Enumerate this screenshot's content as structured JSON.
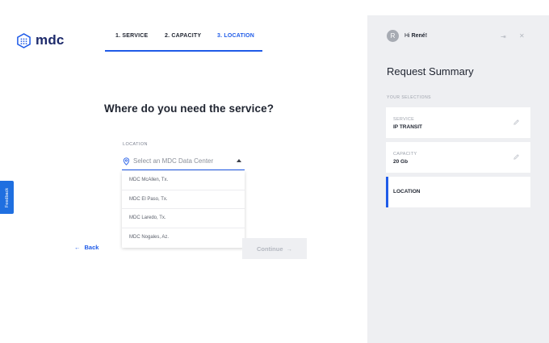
{
  "brand": {
    "name": "mdc",
    "color": "#1d2a6b"
  },
  "steps": [
    {
      "label": "1. SERVICE",
      "active": false
    },
    {
      "label": "2. CAPACITY",
      "active": false
    },
    {
      "label": "3. LOCATION",
      "active": true
    }
  ],
  "question": "Where do you need the service?",
  "location": {
    "label": "LOCATION",
    "placeholder": "Select an MDC Data Center",
    "options": [
      "MDC McAllen, Tx.",
      "MDC El Paso, Tx.",
      "MDC Laredo, Tx.",
      "MDC Nogales, Az."
    ]
  },
  "nav": {
    "back": "Back",
    "continue": "Continue"
  },
  "feedback": "Feedback",
  "summary": {
    "avatar_initial": "R",
    "greeting": "Hi",
    "user_name": "René!",
    "title": "Request Summary",
    "selections_label": "YOUR SELECTIONS",
    "items": [
      {
        "key": "SERVICE",
        "value": "IP TRANSIT"
      },
      {
        "key": "CAPACITY",
        "value": "20 Gb"
      },
      {
        "key": "",
        "value": "LOCATION"
      }
    ]
  },
  "colors": {
    "accent": "#1f5be8",
    "panel_bg": "#eeeff2",
    "feedback": "#1f6fe0"
  }
}
